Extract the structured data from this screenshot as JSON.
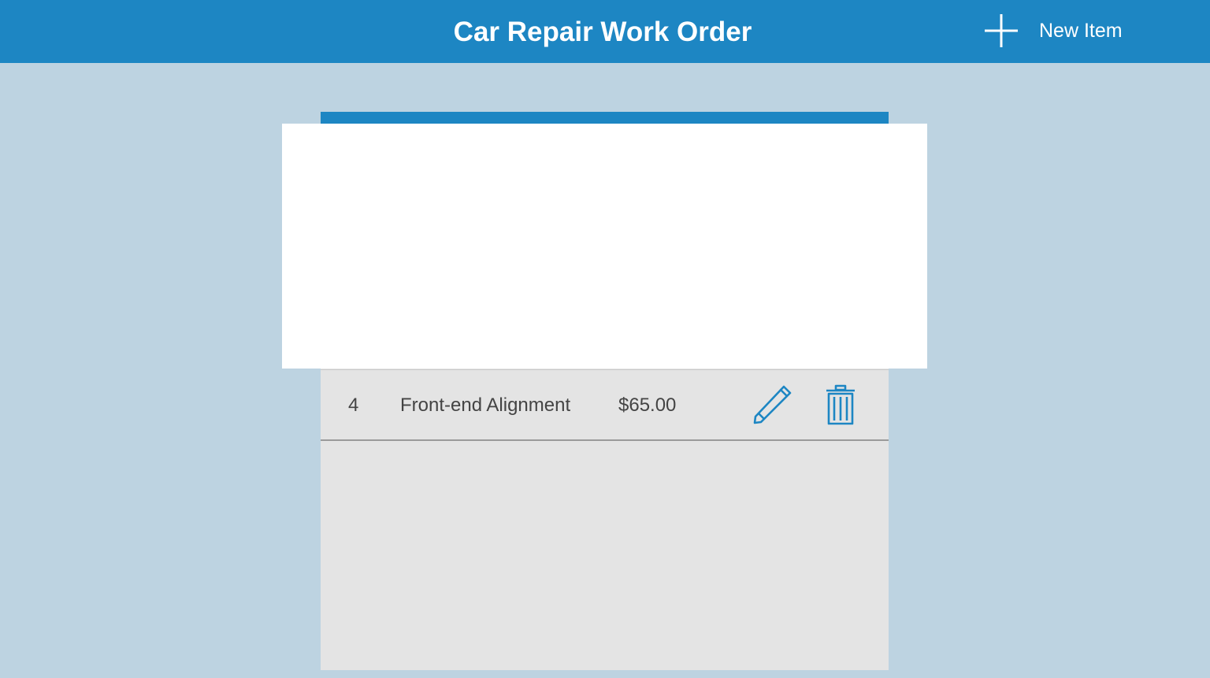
{
  "header": {
    "title": "Car Repair Work Order",
    "new_item_label": "New Item",
    "new_item_icon": "plus-icon",
    "color": "#1d86c3"
  },
  "work_order": {
    "items": [
      {
        "number": "4",
        "description": "Front-end Alignment",
        "price": "$65.00",
        "edit_icon": "pencil-icon",
        "delete_icon": "trash-icon"
      }
    ]
  },
  "colors": {
    "accent": "#1d86c3",
    "background": "#bdd3e1",
    "panel": "#e4e4e4",
    "overlay": "#ffffff",
    "text": "#444444"
  }
}
